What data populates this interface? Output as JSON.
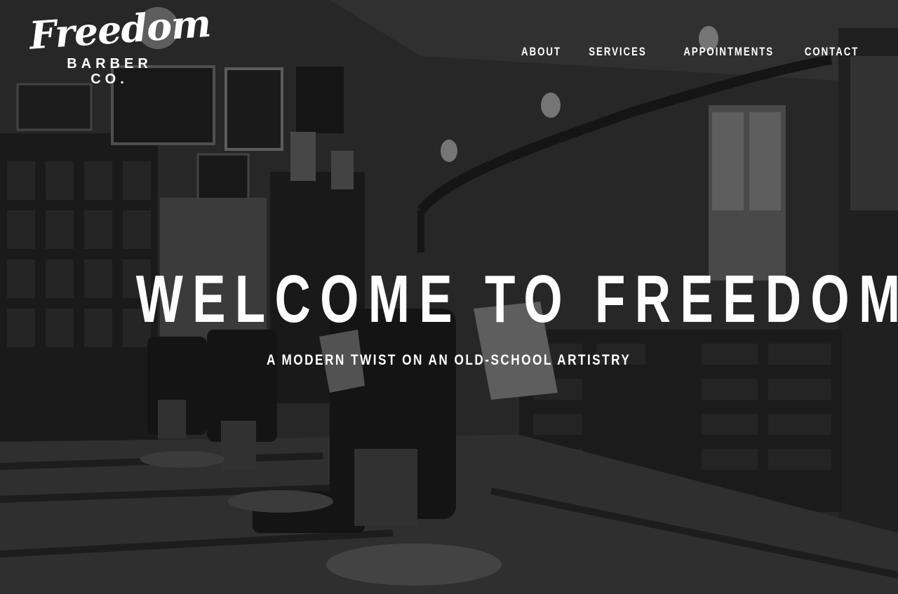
{
  "logo": {
    "script_text": "Freedom",
    "line2": "BARBER",
    "line3": "CO."
  },
  "nav": {
    "items": [
      {
        "label": "ABOUT"
      },
      {
        "label": "SERVICES"
      },
      {
        "label": "APPOINTMENTS"
      },
      {
        "label": "CONTACT"
      }
    ]
  },
  "hero": {
    "headline": "WELCOME TO FREEDOM",
    "tagline": "A MODERN TWIST ON AN OLD-SCHOOL ARTISTRY"
  },
  "colors": {
    "text": "#ffffff",
    "background": "#2a2a2a"
  }
}
